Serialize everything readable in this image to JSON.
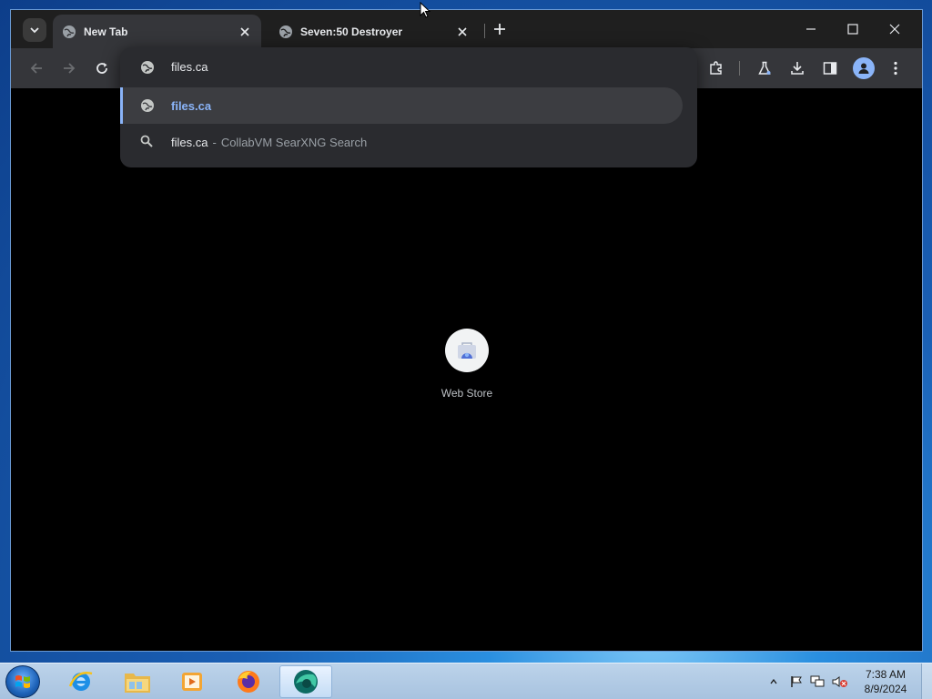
{
  "browser": {
    "tabs": [
      {
        "title": "New Tab",
        "active": true
      },
      {
        "title": "Seven:50 Destroyer",
        "active": false
      }
    ],
    "omnibox": {
      "input_value": "files.ca",
      "suggestions": [
        {
          "main": "files.ca",
          "description": "",
          "icon": "globe-icon",
          "selected": true
        },
        {
          "main": "files.ca",
          "separator": "-",
          "description": "CollabVM SearXNG Search",
          "icon": "search-icon",
          "selected": false
        }
      ]
    },
    "shortcuts": [
      {
        "label": "Web Store",
        "icon": "web-store-icon"
      }
    ],
    "colors": {
      "accent": "#8ab4f8",
      "tab_active": "#35363a",
      "content_bg": "#000000"
    }
  },
  "taskbar": {
    "apps": [
      "internet-explorer-icon",
      "file-explorer-icon",
      "media-player-icon",
      "firefox-icon",
      "browser-icon"
    ],
    "clock": {
      "time": "7:38 AM",
      "date": "8/9/2024"
    }
  }
}
